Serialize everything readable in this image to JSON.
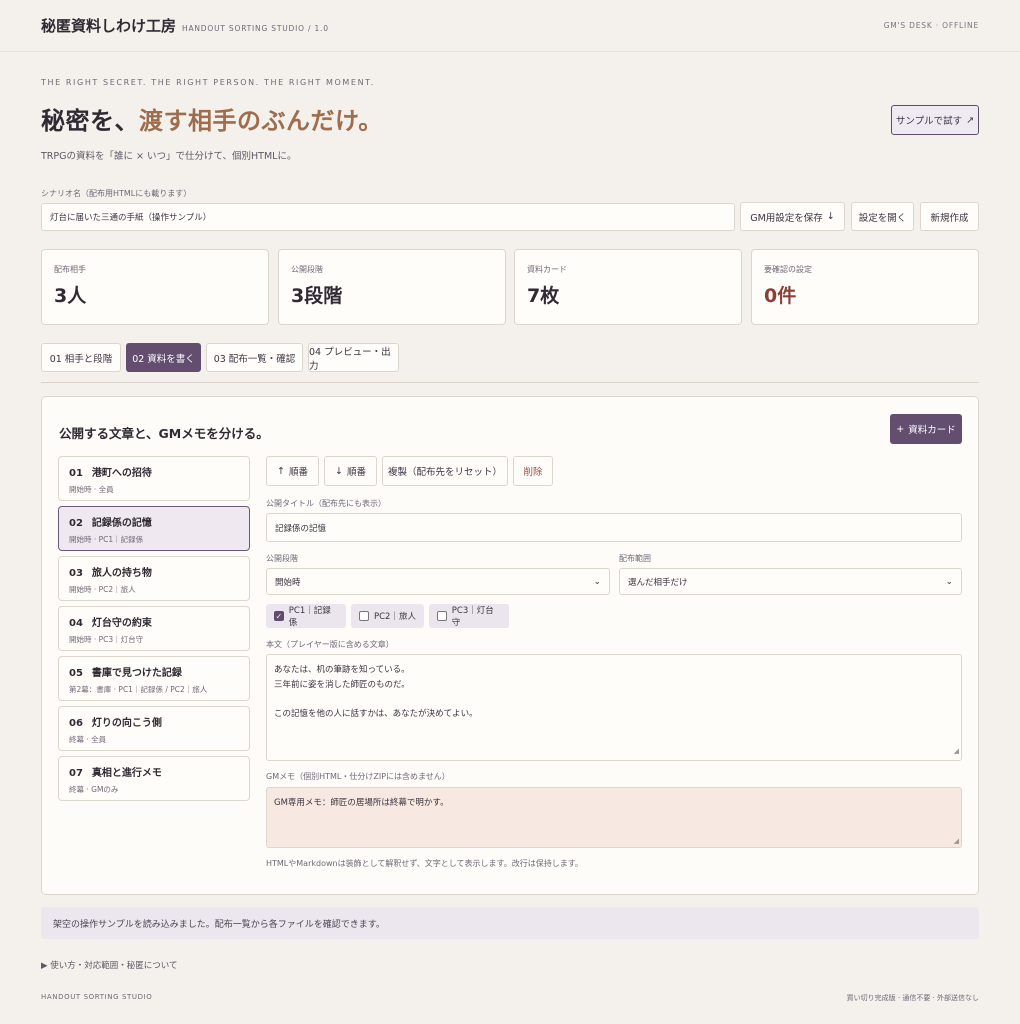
{
  "header": {
    "title": "秘匿資料しわけ工房",
    "subtitle": "HANDOUT SORTING STUDIO / 1.0",
    "status": "GM'S DESK · OFFLINE"
  },
  "hero": {
    "eyebrow": "THE RIGHT SECRET. THE RIGHT PERSON. THE RIGHT MOMENT.",
    "title_main": "秘密を、",
    "title_accent": "渡す相手のぶんだけ。",
    "lead": "TRPGの資料を「誰に × いつ」で仕分けて、個別HTMLに。",
    "sample_button": "サンプルで試す",
    "sample_icon": "↗"
  },
  "scenario": {
    "label": "シナリオ名（配布用HTMLにも載ります）",
    "value": "灯台に届いた三通の手紙（操作サンプル）",
    "save_button": "GM用設定を保存",
    "save_icon": "↓",
    "open_button": "設定を開く",
    "new_button": "新規作成"
  },
  "stats": [
    {
      "label": "配布相手",
      "value": "3人"
    },
    {
      "label": "公開段階",
      "value": "3段階"
    },
    {
      "label": "資料カード",
      "value": "7枚"
    },
    {
      "label": "要確認の設定",
      "value": "0件"
    }
  ],
  "tabs": [
    {
      "label": "01 相手と段階"
    },
    {
      "label": "02 資料を書く"
    },
    {
      "label": "03 配布一覧・確認"
    },
    {
      "label": "04 プレビュー・出力"
    }
  ],
  "editor": {
    "title": "公開する文章と、GMメモを分ける。",
    "add_button": "資料カード",
    "add_icon": "+",
    "cards": [
      {
        "num": "01",
        "title": "港町への招待",
        "meta": "開始時 · 全員"
      },
      {
        "num": "02",
        "title": "記録係の記憶",
        "meta": "開始時 · PC1｜記録係"
      },
      {
        "num": "03",
        "title": "旅人の持ち物",
        "meta": "開始時 · PC2｜旅人"
      },
      {
        "num": "04",
        "title": "灯台守の約束",
        "meta": "開始時 · PC3｜灯台守"
      },
      {
        "num": "05",
        "title": "書庫で見つけた記録",
        "meta": "第2幕：書庫 · PC1｜記録係 / PC2｜旅人"
      },
      {
        "num": "06",
        "title": "灯りの向こう側",
        "meta": "終幕 · 全員"
      },
      {
        "num": "07",
        "title": "真相と進行メモ",
        "meta": "終幕 · GMのみ"
      }
    ],
    "actions": {
      "up": "順番",
      "up_icon": "↑",
      "down": "順番",
      "down_icon": "↓",
      "duplicate": "複製（配布先をリセット）",
      "delete": "削除"
    },
    "public_title_label": "公開タイトル（配布先にも表示）",
    "public_title_value": "記録係の記憶",
    "stage_label": "公開段階",
    "stage_value": "開始時",
    "scope_label": "配布範囲",
    "scope_value": "選んだ相手だけ",
    "recipients": [
      {
        "label": "PC1｜記録係",
        "checked": true
      },
      {
        "label": "PC2｜旅人",
        "checked": false
      },
      {
        "label": "PC3｜灯台守",
        "checked": false
      }
    ],
    "body_label": "本文（プレイヤー版に含める文章）",
    "body_lines": [
      "あなたは、机の筆跡を知っている。",
      "三年前に姿を消した師匠のものだ。",
      "",
      "この記憶を他の人に話すかは、あなたが決めてよい。"
    ],
    "gm_label": "GMメモ（個別HTML・仕分けZIPには含めません）",
    "gm_value": "GM専用メモ：師匠の居場所は終幕で明かす。",
    "hint": "HTMLやMarkdownは装飾として解釈せず、文字として表示します。改行は保持します。"
  },
  "toast": "架空の操作サンプルを読み込みました。配布一覧から各ファイルを確認できます。",
  "details": "▶ 使い方・対応範囲・秘匿について",
  "footer": {
    "left": "HANDOUT SORTING STUDIO",
    "right": "買い切り完成版 · 通信不要 · 外部送信なし"
  },
  "colors": {
    "accent": "#634e70",
    "hero_accent": "#9d6d4d",
    "warn": "#8b3f37",
    "gm_memo_bg": "#f7e9e1"
  }
}
